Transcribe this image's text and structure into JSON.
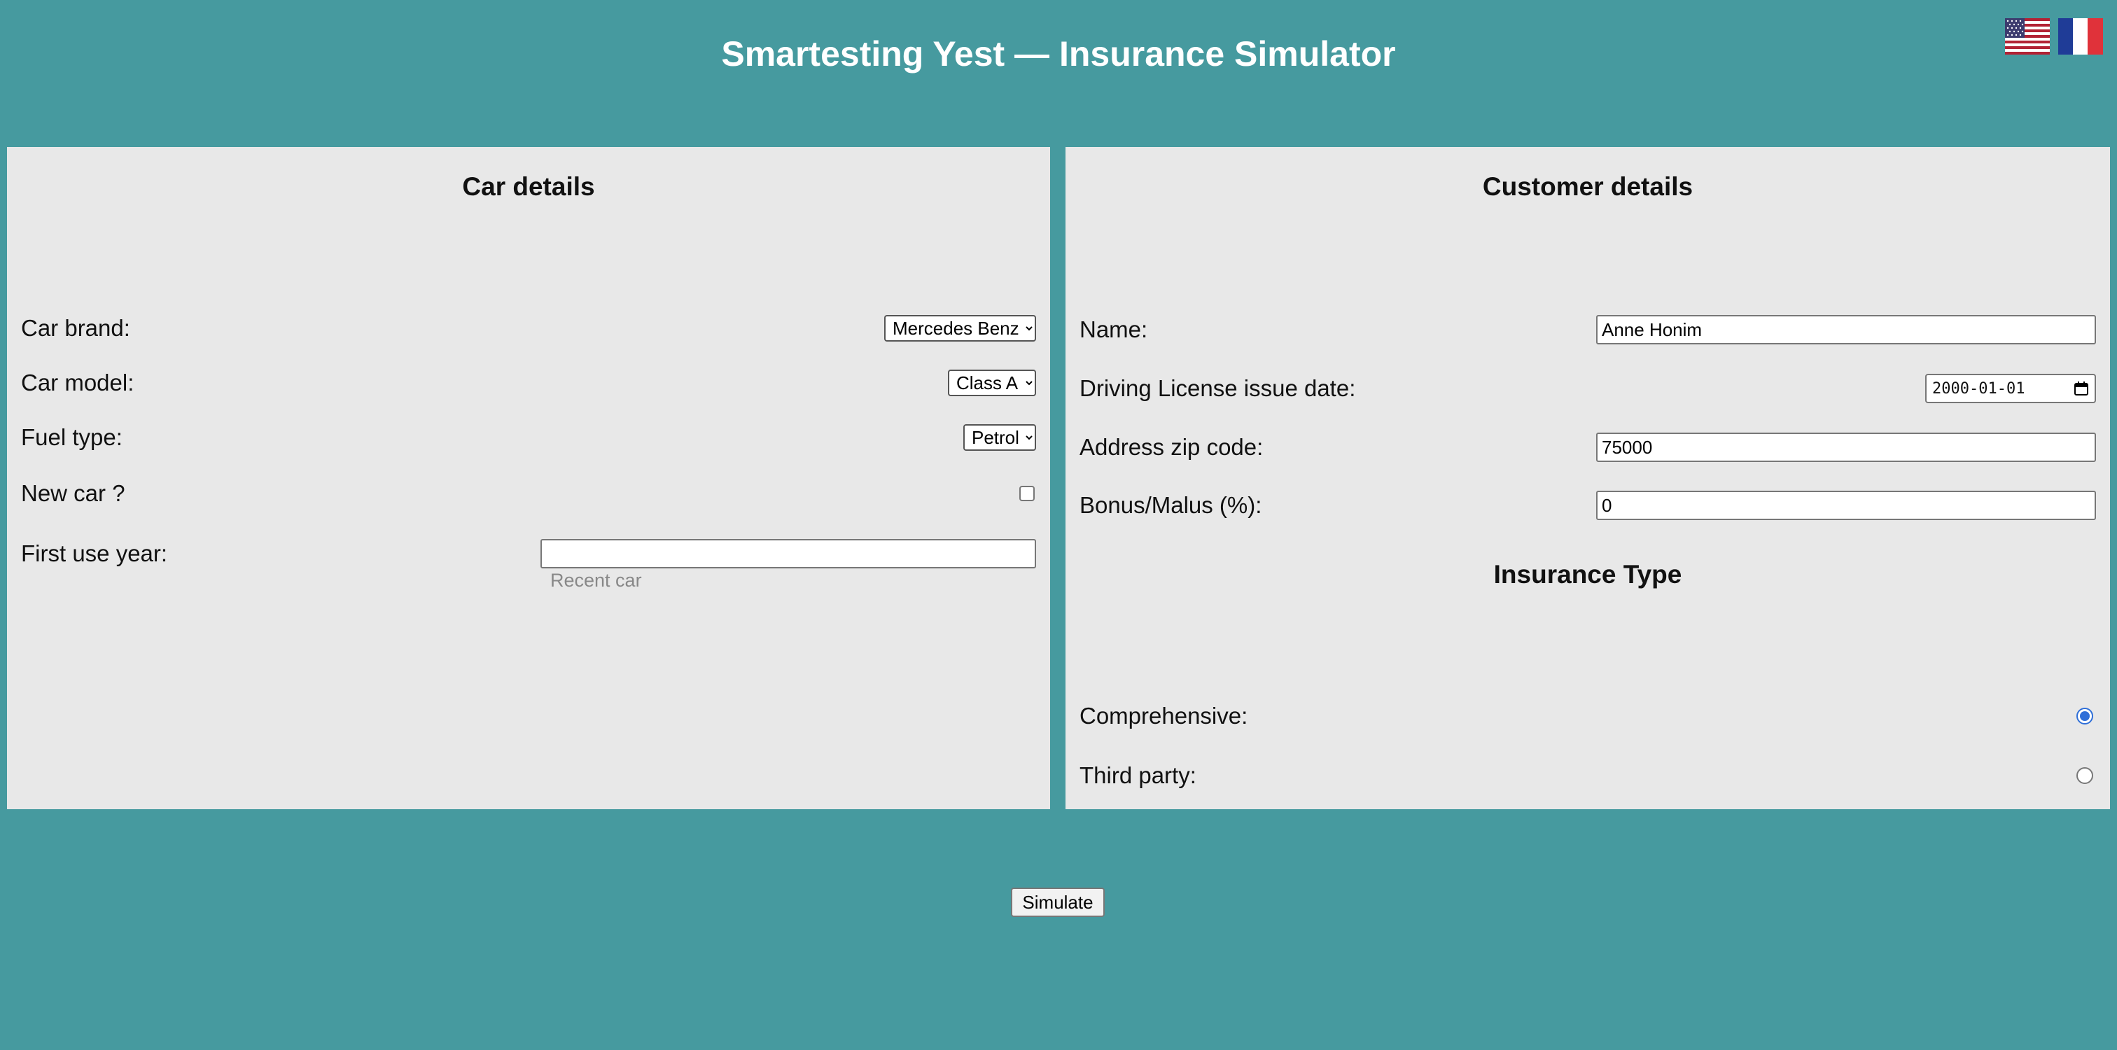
{
  "header": {
    "title": "Smartesting Yest — Insurance Simulator",
    "flags": [
      "us-flag-icon",
      "fr-flag-icon"
    ]
  },
  "car_details": {
    "title": "Car details",
    "brand": {
      "label": "Car brand:",
      "selected": "Mercedes Benz"
    },
    "model": {
      "label": "Car model:",
      "selected": "Class A"
    },
    "fuel": {
      "label": "Fuel type:",
      "selected": "Petrol"
    },
    "new_car": {
      "label": "New car ?",
      "checked": false
    },
    "first_use_year": {
      "label": "First use year:",
      "value": "",
      "helper": "Recent car"
    }
  },
  "customer_details": {
    "title": "Customer details",
    "name": {
      "label": "Name:",
      "value": "Anne Honim"
    },
    "license_date": {
      "label": "Driving License issue date:",
      "value": "2000-01-01"
    },
    "zip": {
      "label": "Address zip code:",
      "value": "75000"
    },
    "bonus_malus": {
      "label": "Bonus/Malus (%):",
      "value": "0"
    }
  },
  "insurance_type": {
    "title": "Insurance Type",
    "comprehensive": {
      "label": "Comprehensive:",
      "checked": true
    },
    "third_party": {
      "label": "Third party:",
      "checked": false
    }
  },
  "actions": {
    "simulate_label": "Simulate"
  },
  "colors": {
    "background": "#469a9f",
    "panel": "#e8e8e8",
    "radio_accent": "#2f6fd8"
  }
}
